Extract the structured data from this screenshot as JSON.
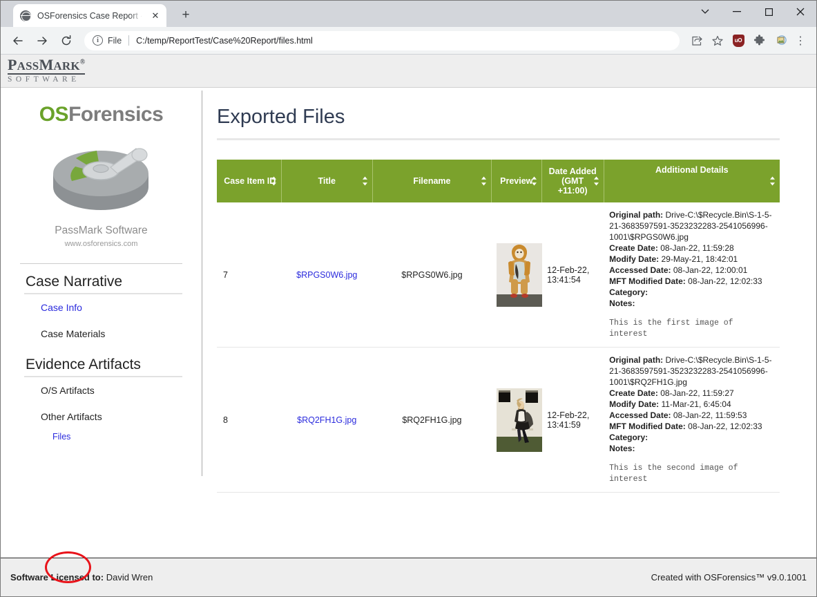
{
  "browser": {
    "tab_title": "OSForensics Case Report - Testing",
    "tab_close_label": "✕",
    "new_tab_label": "+",
    "back_label": "←",
    "forward_label": "→",
    "reload_label": "⟳",
    "info_label": "i",
    "file_label": "File",
    "url": "C:/temp/ReportTest/Case%20Report/files.html",
    "ublock_label": "uO",
    "menu_label": "⋮",
    "window_dropdown": "⌄",
    "window_minimize": "—",
    "window_maximize": "□",
    "window_close": "✕"
  },
  "brand": {
    "pass": "P",
    "ass": "ASS",
    "m": "M",
    "ark": "ARK",
    "registered": "®",
    "software": "SOFTWARE"
  },
  "sidebar": {
    "logo_os": "OS",
    "logo_forensics": "Forensics",
    "company": "PassMark Software",
    "website": "www.osforensics.com",
    "sections": [
      {
        "heading": "Case Narrative",
        "items": [
          {
            "label": "Case Info",
            "link": true
          },
          {
            "label": "Case Materials",
            "link": false
          }
        ]
      },
      {
        "heading": "Evidence Artifacts",
        "items": [
          {
            "label": "O/S Artifacts",
            "link": false
          },
          {
            "label": "Other Artifacts",
            "link": false
          }
        ],
        "sub_items": [
          {
            "label": "Files",
            "link": true,
            "annotated": true
          }
        ]
      }
    ]
  },
  "main": {
    "title": "Exported Files",
    "table": {
      "columns": [
        {
          "label": "Case Item ID",
          "sortable": true
        },
        {
          "label": "Title",
          "sortable": true
        },
        {
          "label": "Filename",
          "sortable": true
        },
        {
          "label": "Preview",
          "sortable": true
        },
        {
          "label": "Date Added (GMT +11:00)",
          "sortable": true
        },
        {
          "label": "Additional Details",
          "sortable": true
        }
      ],
      "rows": [
        {
          "case_item_id": "7",
          "title": "$RPGS0W6.jpg",
          "filename": "$RPGS0W6.jpg",
          "preview_alt": "thumbnail-lion-costume",
          "date_added": "12-Feb-22, 13:41:54",
          "details": {
            "original_path_label": "Original path:",
            "original_path": "Drive-C:\\$Recycle.Bin\\S-1-5-21-3683597591-3523232283-2541056996-1001\\$RPGS0W6.jpg",
            "create_date_label": "Create Date:",
            "create_date": "08-Jan-22, 11:59:28",
            "modify_date_label": "Modify Date:",
            "modify_date": "29-May-21, 18:42:01",
            "accessed_date_label": "Accessed Date:",
            "accessed_date": "08-Jan-22, 12:00:01",
            "mft_modified_label": "MFT Modified Date:",
            "mft_modified": "08-Jan-22, 12:02:33",
            "category_label": "Category:",
            "category": "",
            "notes_label": "Notes:",
            "notes": "This is the first image of interest"
          }
        },
        {
          "case_item_id": "8",
          "title": "$RQ2FH1G.jpg",
          "filename": "$RQ2FH1G.jpg",
          "preview_alt": "thumbnail-person-jumping",
          "date_added": "12-Feb-22, 13:41:59",
          "details": {
            "original_path_label": "Original path:",
            "original_path": "Drive-C:\\$Recycle.Bin\\S-1-5-21-3683597591-3523232283-2541056996-1001\\$RQ2FH1G.jpg",
            "create_date_label": "Create Date:",
            "create_date": "08-Jan-22, 11:59:27",
            "modify_date_label": "Modify Date:",
            "modify_date": "11-Mar-21, 6:45:04",
            "accessed_date_label": "Accessed Date:",
            "accessed_date": "08-Jan-22, 11:59:53",
            "mft_modified_label": "MFT Modified Date:",
            "mft_modified": "08-Jan-22, 12:02:33",
            "category_label": "Category:",
            "category": "",
            "notes_label": "Notes:",
            "notes": "This is the second image of interest"
          }
        }
      ]
    }
  },
  "footer": {
    "license_label": "Software Licensed to:",
    "license_name": "David Wren",
    "created_with": "Created with OSForensics™ v9.0.1001"
  },
  "colors": {
    "header_green": "#7ba22c",
    "link_blue": "#2b2bdd",
    "annotation_red": "#e8131a",
    "logo_green": "#6aa22a"
  }
}
